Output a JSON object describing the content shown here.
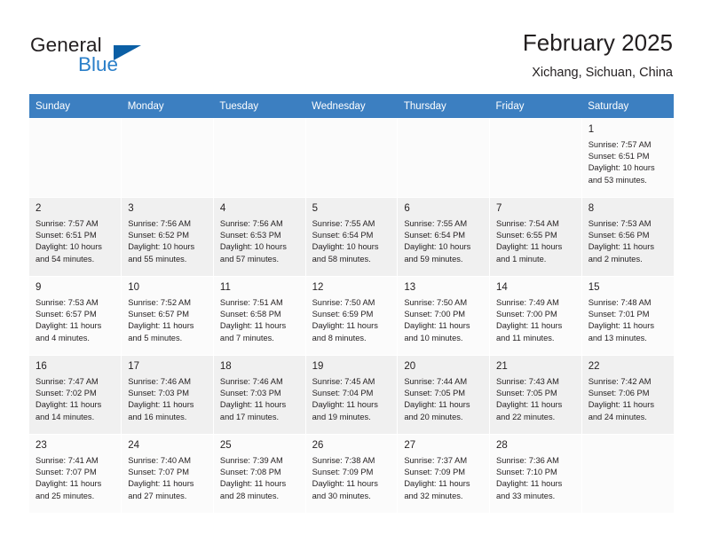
{
  "brand": {
    "name_part1": "General",
    "name_part2": "Blue",
    "accent_color": "#2a7fc9",
    "triangle_color": "#0b5fa5"
  },
  "header": {
    "title": "February 2025",
    "location": "Xichang, Sichuan, China"
  },
  "calendar": {
    "header_bg": "#3c7fc1",
    "weekdays": [
      "Sunday",
      "Monday",
      "Tuesday",
      "Wednesday",
      "Thursday",
      "Friday",
      "Saturday"
    ],
    "weeks": [
      [
        {
          "empty": true
        },
        {
          "empty": true
        },
        {
          "empty": true
        },
        {
          "empty": true
        },
        {
          "empty": true
        },
        {
          "empty": true
        },
        {
          "day": "1",
          "sunrise": "Sunrise: 7:57 AM",
          "sunset": "Sunset: 6:51 PM",
          "daylight1": "Daylight: 10 hours",
          "daylight2": "and 53 minutes."
        }
      ],
      [
        {
          "day": "2",
          "sunrise": "Sunrise: 7:57 AM",
          "sunset": "Sunset: 6:51 PM",
          "daylight1": "Daylight: 10 hours",
          "daylight2": "and 54 minutes."
        },
        {
          "day": "3",
          "sunrise": "Sunrise: 7:56 AM",
          "sunset": "Sunset: 6:52 PM",
          "daylight1": "Daylight: 10 hours",
          "daylight2": "and 55 minutes."
        },
        {
          "day": "4",
          "sunrise": "Sunrise: 7:56 AM",
          "sunset": "Sunset: 6:53 PM",
          "daylight1": "Daylight: 10 hours",
          "daylight2": "and 57 minutes."
        },
        {
          "day": "5",
          "sunrise": "Sunrise: 7:55 AM",
          "sunset": "Sunset: 6:54 PM",
          "daylight1": "Daylight: 10 hours",
          "daylight2": "and 58 minutes."
        },
        {
          "day": "6",
          "sunrise": "Sunrise: 7:55 AM",
          "sunset": "Sunset: 6:54 PM",
          "daylight1": "Daylight: 10 hours",
          "daylight2": "and 59 minutes."
        },
        {
          "day": "7",
          "sunrise": "Sunrise: 7:54 AM",
          "sunset": "Sunset: 6:55 PM",
          "daylight1": "Daylight: 11 hours",
          "daylight2": "and 1 minute."
        },
        {
          "day": "8",
          "sunrise": "Sunrise: 7:53 AM",
          "sunset": "Sunset: 6:56 PM",
          "daylight1": "Daylight: 11 hours",
          "daylight2": "and 2 minutes."
        }
      ],
      [
        {
          "day": "9",
          "sunrise": "Sunrise: 7:53 AM",
          "sunset": "Sunset: 6:57 PM",
          "daylight1": "Daylight: 11 hours",
          "daylight2": "and 4 minutes."
        },
        {
          "day": "10",
          "sunrise": "Sunrise: 7:52 AM",
          "sunset": "Sunset: 6:57 PM",
          "daylight1": "Daylight: 11 hours",
          "daylight2": "and 5 minutes."
        },
        {
          "day": "11",
          "sunrise": "Sunrise: 7:51 AM",
          "sunset": "Sunset: 6:58 PM",
          "daylight1": "Daylight: 11 hours",
          "daylight2": "and 7 minutes."
        },
        {
          "day": "12",
          "sunrise": "Sunrise: 7:50 AM",
          "sunset": "Sunset: 6:59 PM",
          "daylight1": "Daylight: 11 hours",
          "daylight2": "and 8 minutes."
        },
        {
          "day": "13",
          "sunrise": "Sunrise: 7:50 AM",
          "sunset": "Sunset: 7:00 PM",
          "daylight1": "Daylight: 11 hours",
          "daylight2": "and 10 minutes."
        },
        {
          "day": "14",
          "sunrise": "Sunrise: 7:49 AM",
          "sunset": "Sunset: 7:00 PM",
          "daylight1": "Daylight: 11 hours",
          "daylight2": "and 11 minutes."
        },
        {
          "day": "15",
          "sunrise": "Sunrise: 7:48 AM",
          "sunset": "Sunset: 7:01 PM",
          "daylight1": "Daylight: 11 hours",
          "daylight2": "and 13 minutes."
        }
      ],
      [
        {
          "day": "16",
          "sunrise": "Sunrise: 7:47 AM",
          "sunset": "Sunset: 7:02 PM",
          "daylight1": "Daylight: 11 hours",
          "daylight2": "and 14 minutes."
        },
        {
          "day": "17",
          "sunrise": "Sunrise: 7:46 AM",
          "sunset": "Sunset: 7:03 PM",
          "daylight1": "Daylight: 11 hours",
          "daylight2": "and 16 minutes."
        },
        {
          "day": "18",
          "sunrise": "Sunrise: 7:46 AM",
          "sunset": "Sunset: 7:03 PM",
          "daylight1": "Daylight: 11 hours",
          "daylight2": "and 17 minutes."
        },
        {
          "day": "19",
          "sunrise": "Sunrise: 7:45 AM",
          "sunset": "Sunset: 7:04 PM",
          "daylight1": "Daylight: 11 hours",
          "daylight2": "and 19 minutes."
        },
        {
          "day": "20",
          "sunrise": "Sunrise: 7:44 AM",
          "sunset": "Sunset: 7:05 PM",
          "daylight1": "Daylight: 11 hours",
          "daylight2": "and 20 minutes."
        },
        {
          "day": "21",
          "sunrise": "Sunrise: 7:43 AM",
          "sunset": "Sunset: 7:05 PM",
          "daylight1": "Daylight: 11 hours",
          "daylight2": "and 22 minutes."
        },
        {
          "day": "22",
          "sunrise": "Sunrise: 7:42 AM",
          "sunset": "Sunset: 7:06 PM",
          "daylight1": "Daylight: 11 hours",
          "daylight2": "and 24 minutes."
        }
      ],
      [
        {
          "day": "23",
          "sunrise": "Sunrise: 7:41 AM",
          "sunset": "Sunset: 7:07 PM",
          "daylight1": "Daylight: 11 hours",
          "daylight2": "and 25 minutes."
        },
        {
          "day": "24",
          "sunrise": "Sunrise: 7:40 AM",
          "sunset": "Sunset: 7:07 PM",
          "daylight1": "Daylight: 11 hours",
          "daylight2": "and 27 minutes."
        },
        {
          "day": "25",
          "sunrise": "Sunrise: 7:39 AM",
          "sunset": "Sunset: 7:08 PM",
          "daylight1": "Daylight: 11 hours",
          "daylight2": "and 28 minutes."
        },
        {
          "day": "26",
          "sunrise": "Sunrise: 7:38 AM",
          "sunset": "Sunset: 7:09 PM",
          "daylight1": "Daylight: 11 hours",
          "daylight2": "and 30 minutes."
        },
        {
          "day": "27",
          "sunrise": "Sunrise: 7:37 AM",
          "sunset": "Sunset: 7:09 PM",
          "daylight1": "Daylight: 11 hours",
          "daylight2": "and 32 minutes."
        },
        {
          "day": "28",
          "sunrise": "Sunrise: 7:36 AM",
          "sunset": "Sunset: 7:10 PM",
          "daylight1": "Daylight: 11 hours",
          "daylight2": "and 33 minutes."
        },
        {
          "empty": true
        }
      ]
    ]
  }
}
